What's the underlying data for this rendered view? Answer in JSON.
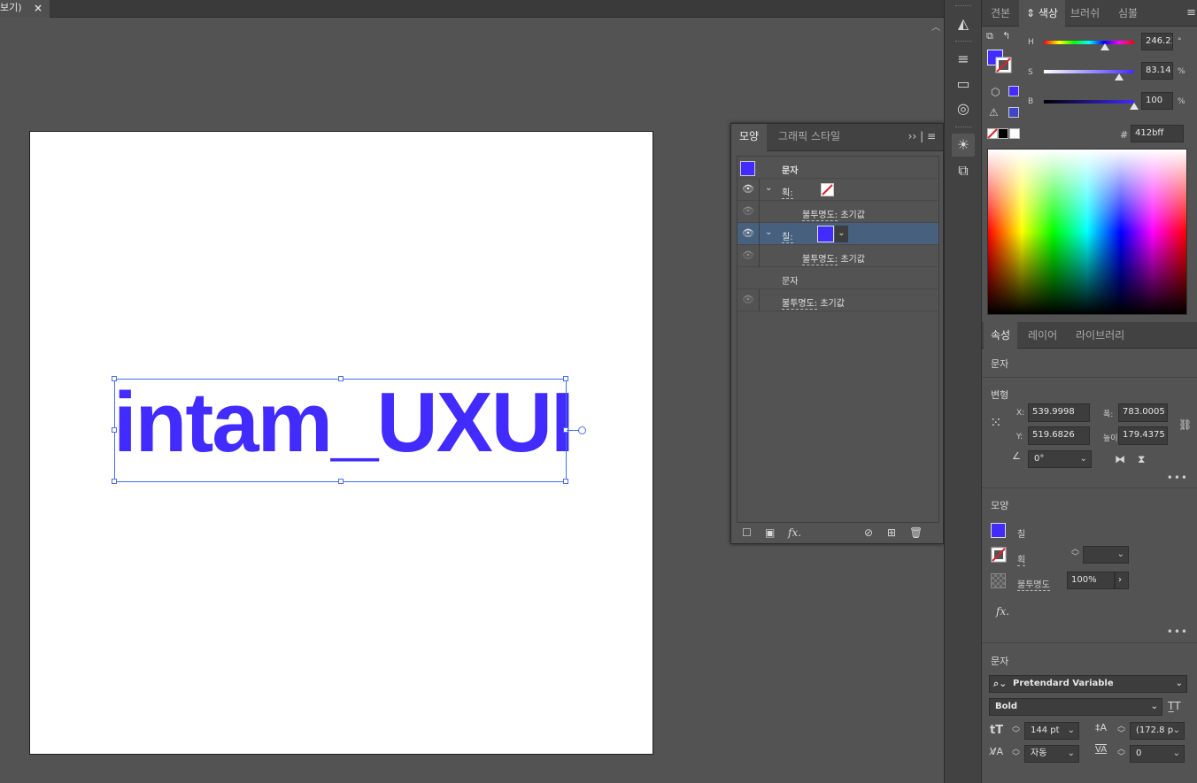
{
  "doc_tab": {
    "label": "보기)",
    "close": "×"
  },
  "artwork": {
    "text": "intam_UXUI",
    "color": "#412bff"
  },
  "appearance_panel": {
    "tabs": [
      "모양",
      "그래픽 스타일"
    ],
    "rows": {
      "text_header": "문자",
      "stroke_label": "획:",
      "stroke_opacity": "불투명도:",
      "stroke_opacity_val": "초기값",
      "fill_label": "칠:",
      "fill_opacity": "불투명도:",
      "fill_opacity_val": "초기값",
      "chars": "문자",
      "obj_opacity": "불투명도:",
      "obj_opacity_val": "초기값"
    },
    "footer_fx": "fx."
  },
  "color_panel": {
    "tabs": [
      "견본",
      "색상",
      "브러쉬",
      "심볼"
    ],
    "h_label": "H",
    "h_value": "246.23",
    "h_unit": "°",
    "s_label": "S",
    "s_value": "83.14",
    "s_unit": "%",
    "b_label": "B",
    "b_value": "100",
    "b_unit": "%",
    "hex_label": "#",
    "hex_value": "412bff",
    "fill_color": "#412bff"
  },
  "properties_panel": {
    "tabs": [
      "속성",
      "레이어",
      "라이브러리"
    ],
    "object_type": "문자",
    "transform": {
      "title": "변형",
      "x_label": "X:",
      "x_value": "539.9998",
      "y_label": "Y:",
      "y_value": "519.6826",
      "w_label": "폭:",
      "w_value": "783.0005",
      "h_label": "높이:",
      "h_value": "179.4375",
      "angle_value": "0°"
    },
    "appearance": {
      "title": "모양",
      "fill_label": "칠",
      "stroke_label": "획",
      "opacity_label": "불투명도",
      "opacity_value": "100%",
      "fx": "fx."
    },
    "character": {
      "title": "문자",
      "font_family": "Pretendard Variable",
      "font_style": "Bold",
      "font_size": "144 pt",
      "leading": "(172.8 p",
      "kerning": "자동",
      "tracking": "0"
    }
  }
}
